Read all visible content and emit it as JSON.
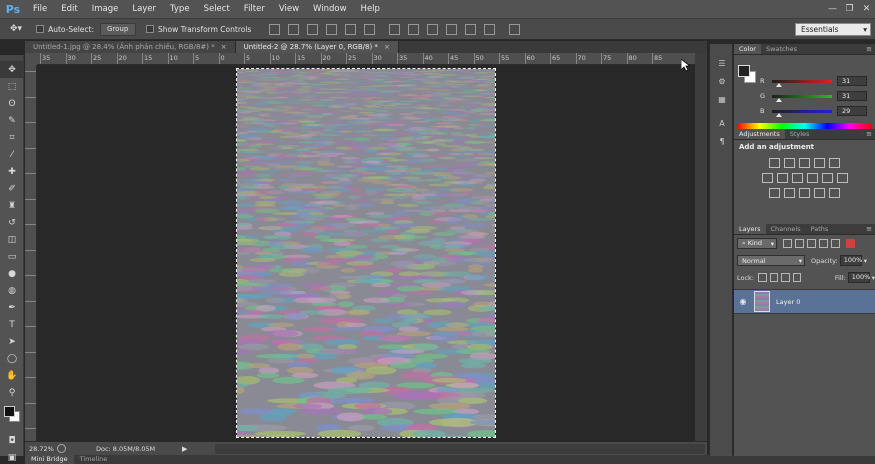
{
  "app": {
    "logo": "Ps"
  },
  "menu": [
    "File",
    "Edit",
    "Image",
    "Layer",
    "Type",
    "Select",
    "Filter",
    "View",
    "Window",
    "Help"
  ],
  "window_controls": {
    "minimize": "—",
    "restore": "❐",
    "close": "✕"
  },
  "options": {
    "tool_glyph": "✥▾",
    "auto_select_label": "Auto-Select:",
    "auto_select_value": "Group",
    "show_transform_label": "Show Transform Controls",
    "workspace": "Essentials"
  },
  "tabs": [
    {
      "label": "Untitled-1.jpg @ 28.4% (Ảnh phản chiếu, RGB/8#) *",
      "close": "×"
    },
    {
      "label": "Untitled-2 @ 28.7% (Layer 0, RGB/8) *",
      "close": "×"
    }
  ],
  "ruler": {
    "h_labels": [
      "35",
      "30",
      "25",
      "20",
      "15",
      "10",
      "5",
      "0",
      "5",
      "10",
      "15",
      "20",
      "25",
      "30",
      "35",
      "40",
      "45",
      "50",
      "55",
      "60",
      "65",
      "70",
      "75",
      "80",
      "85"
    ]
  },
  "status": {
    "zoom": "28.72%",
    "doc": "Doc: 8.05M/8.05M",
    "arrow": "▶"
  },
  "bottom_tabs": [
    "Mini Bridge",
    "Timeline"
  ],
  "tools": [
    {
      "name": "move-tool",
      "glyph": "✥"
    },
    {
      "name": "marquee-tool",
      "glyph": "⬚"
    },
    {
      "name": "lasso-tool",
      "glyph": "ʘ"
    },
    {
      "name": "quick-select-tool",
      "glyph": "✎"
    },
    {
      "name": "crop-tool",
      "glyph": "⌗"
    },
    {
      "name": "eyedropper-tool",
      "glyph": "⁄"
    },
    {
      "name": "healing-brush-tool",
      "glyph": "✚"
    },
    {
      "name": "brush-tool",
      "glyph": "✐"
    },
    {
      "name": "clone-stamp-tool",
      "glyph": "♜"
    },
    {
      "name": "history-brush-tool",
      "glyph": "↺"
    },
    {
      "name": "eraser-tool",
      "glyph": "◫"
    },
    {
      "name": "gradient-tool",
      "glyph": "▭"
    },
    {
      "name": "blur-tool",
      "glyph": "●"
    },
    {
      "name": "dodge-tool",
      "glyph": "◍"
    },
    {
      "name": "pen-tool",
      "glyph": "✒"
    },
    {
      "name": "type-tool",
      "glyph": "T"
    },
    {
      "name": "path-select-tool",
      "glyph": "➤"
    },
    {
      "name": "shape-tool",
      "glyph": "◯"
    },
    {
      "name": "hand-tool",
      "glyph": "✋"
    },
    {
      "name": "zoom-tool",
      "glyph": "⚲"
    }
  ],
  "icon_strip": [
    "☰",
    "⚙",
    "▦",
    "A",
    "¶"
  ],
  "color_panel": {
    "tabs": [
      "Color",
      "Swatches"
    ],
    "channels": [
      {
        "label": "R",
        "value": "31",
        "fraction": 0.12,
        "color": "#e02020"
      },
      {
        "label": "G",
        "value": "31",
        "fraction": 0.12,
        "color": "#20c020"
      },
      {
        "label": "B",
        "value": "29",
        "fraction": 0.11,
        "color": "#2020e0"
      }
    ]
  },
  "adjustments_panel": {
    "tabs": [
      "Adjustments",
      "Styles"
    ],
    "title": "Add an adjustment",
    "rows": [
      [
        "brightness",
        "levels",
        "curves",
        "exposure",
        "vibrance"
      ],
      [
        "hue-saturation",
        "color-balance",
        "black-white",
        "photo-filter",
        "channel-mixer",
        "color-lookup"
      ],
      [
        "invert",
        "posterize",
        "threshold",
        "gradient-map",
        "selective-color"
      ]
    ]
  },
  "layers_panel": {
    "tabs": [
      "Layers",
      "Channels",
      "Paths"
    ],
    "kind_label": "⌕ Kind",
    "blend_mode": "Normal",
    "opacity_label": "Opacity:",
    "opacity_value": "100%",
    "lock_label": "Lock:",
    "fill_label": "Fill:",
    "fill_value": "100%",
    "layer": {
      "name": "Layer 0",
      "eye": "◉"
    },
    "footer_icons": [
      "∞",
      "fx",
      "◙",
      "◐",
      "▭",
      "⎗",
      "🗑"
    ]
  },
  "panel_menu_glyph": "≡"
}
